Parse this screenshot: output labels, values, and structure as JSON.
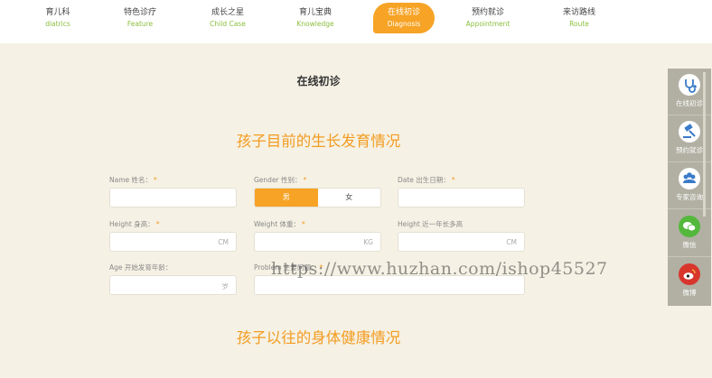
{
  "nav": {
    "items": [
      {
        "cn": "育儿科",
        "en": "diatrics"
      },
      {
        "cn": "特色诊疗",
        "en": "Feature"
      },
      {
        "cn": "成长之星",
        "en": "Child Case"
      },
      {
        "cn": "育儿宝典",
        "en": "Knowledge"
      },
      {
        "cn": "在线初诊",
        "en": "Diagnosis"
      },
      {
        "cn": "预约就诊",
        "en": "Appointment"
      },
      {
        "cn": "来访路线",
        "en": "Route"
      }
    ],
    "active_index": 4
  },
  "page": {
    "title": "在线初诊",
    "section1_title": "孩子目前的生长发育情况",
    "section2_title": "孩子以往的身体健康情况"
  },
  "form": {
    "name_label": "Name 姓名：",
    "gender_label": "Gender 性别：",
    "dob_label": "Date 出生日期：",
    "height_label": "Height 身高：",
    "weight_label": "Weight 体重：",
    "growth_label": "Height 近一年长多高",
    "age_label": "Age 开始发育年龄：",
    "problem_label": "Problem 主要问题：",
    "required_mark": "*",
    "gender_male": "男",
    "gender_female": "女",
    "unit_cm": "CM",
    "unit_kg": "KG",
    "unit_age": "岁"
  },
  "sidebar": {
    "items": [
      {
        "label": "在线初诊",
        "icon": "stethoscope-icon"
      },
      {
        "label": "预约就诊",
        "icon": "gavel-icon"
      },
      {
        "label": "专家咨询",
        "icon": "experts-icon"
      },
      {
        "label": "微信",
        "icon": "wechat-icon"
      },
      {
        "label": "微博",
        "icon": "weibo-icon"
      }
    ]
  },
  "watermark": "https://www.huzhan.com/ishop45527",
  "colors": {
    "accent": "#f7a325",
    "nav_en": "#8cbf3f",
    "background": "#f5f1e4",
    "sidebar": "#b1b0a3"
  }
}
